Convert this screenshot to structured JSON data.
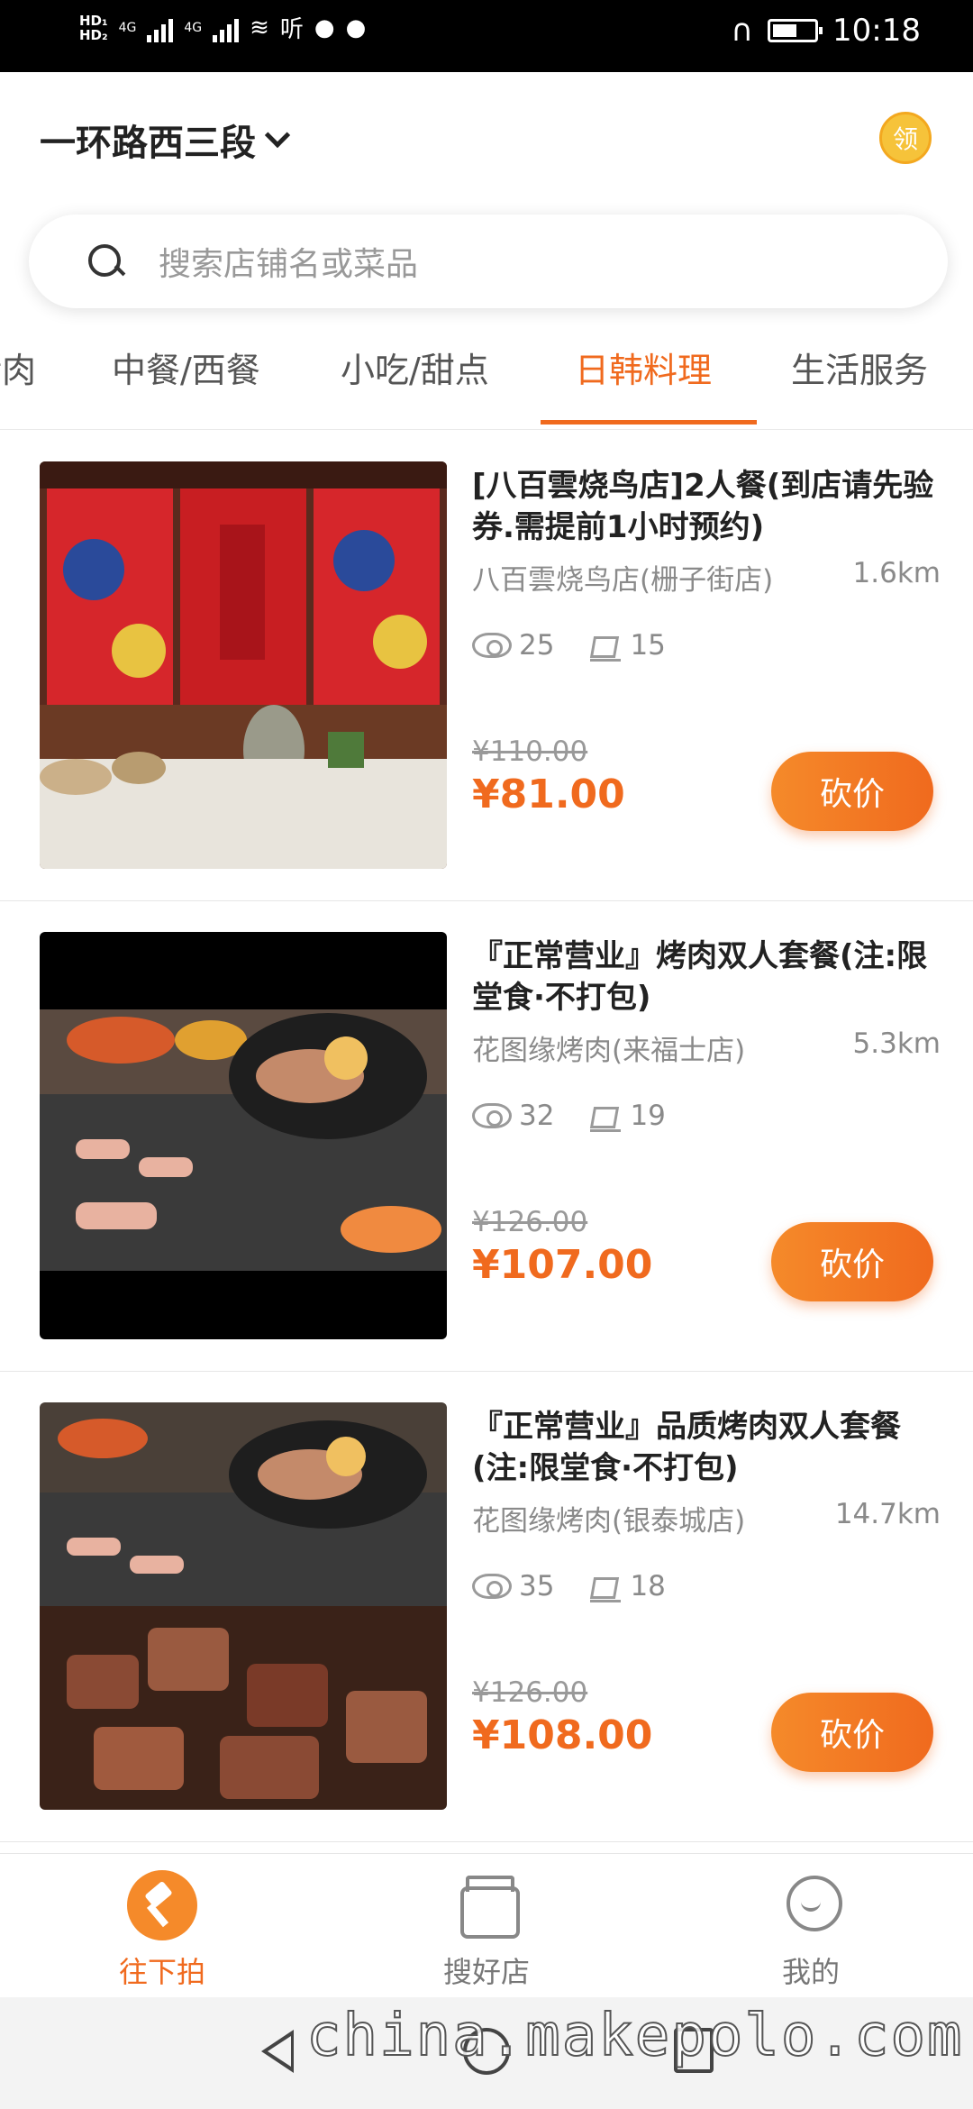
{
  "status_bar": {
    "hd1": "HD₁",
    "hd2": "HD₂",
    "net1": "4G",
    "net2": "4G",
    "extra": "听",
    "time": "10:18"
  },
  "header": {
    "location": "一环路西三段",
    "coupon_label": "领"
  },
  "search": {
    "placeholder": "搜索店铺名或菜品"
  },
  "tabs": [
    {
      "label": "烤肉"
    },
    {
      "label": "中餐/西餐"
    },
    {
      "label": "小吃/甜点"
    },
    {
      "label": "日韩料理",
      "active": true
    },
    {
      "label": "生活服务"
    }
  ],
  "deals": [
    {
      "title": "[八百雲烧鸟店]2人餐(到店请先验券.需提前1小时预约)",
      "shop": "八百雲烧鸟店(栅子街店)",
      "distance": "1.6km",
      "views": "25",
      "sold": "15",
      "old_price": "¥110.00",
      "price": "¥81.00",
      "action": "砍价"
    },
    {
      "title": "『正常营业』烤肉双人套餐(注:限堂食·不打包)",
      "shop": "花图缘烤肉(来福士店)",
      "distance": "5.3km",
      "views": "32",
      "sold": "19",
      "old_price": "¥126.00",
      "price": "¥107.00",
      "action": "砍价"
    },
    {
      "title": "『正常营业』品质烤肉双人套餐(注:限堂食·不打包)",
      "shop": "花图缘烤肉(银泰城店)",
      "distance": "14.7km",
      "views": "35",
      "sold": "18",
      "old_price": "¥126.00",
      "price": "¥108.00",
      "action": "砍价"
    }
  ],
  "bottom_nav": [
    {
      "label": "往下拍",
      "icon": "gavel-icon",
      "active": true
    },
    {
      "label": "搜好店",
      "icon": "shop-icon"
    },
    {
      "label": "我的",
      "icon": "user-icon"
    }
  ],
  "watermark": "china.makepolo.com",
  "colors": {
    "accent": "#f06a1e",
    "coupon": "#f6c33a"
  }
}
